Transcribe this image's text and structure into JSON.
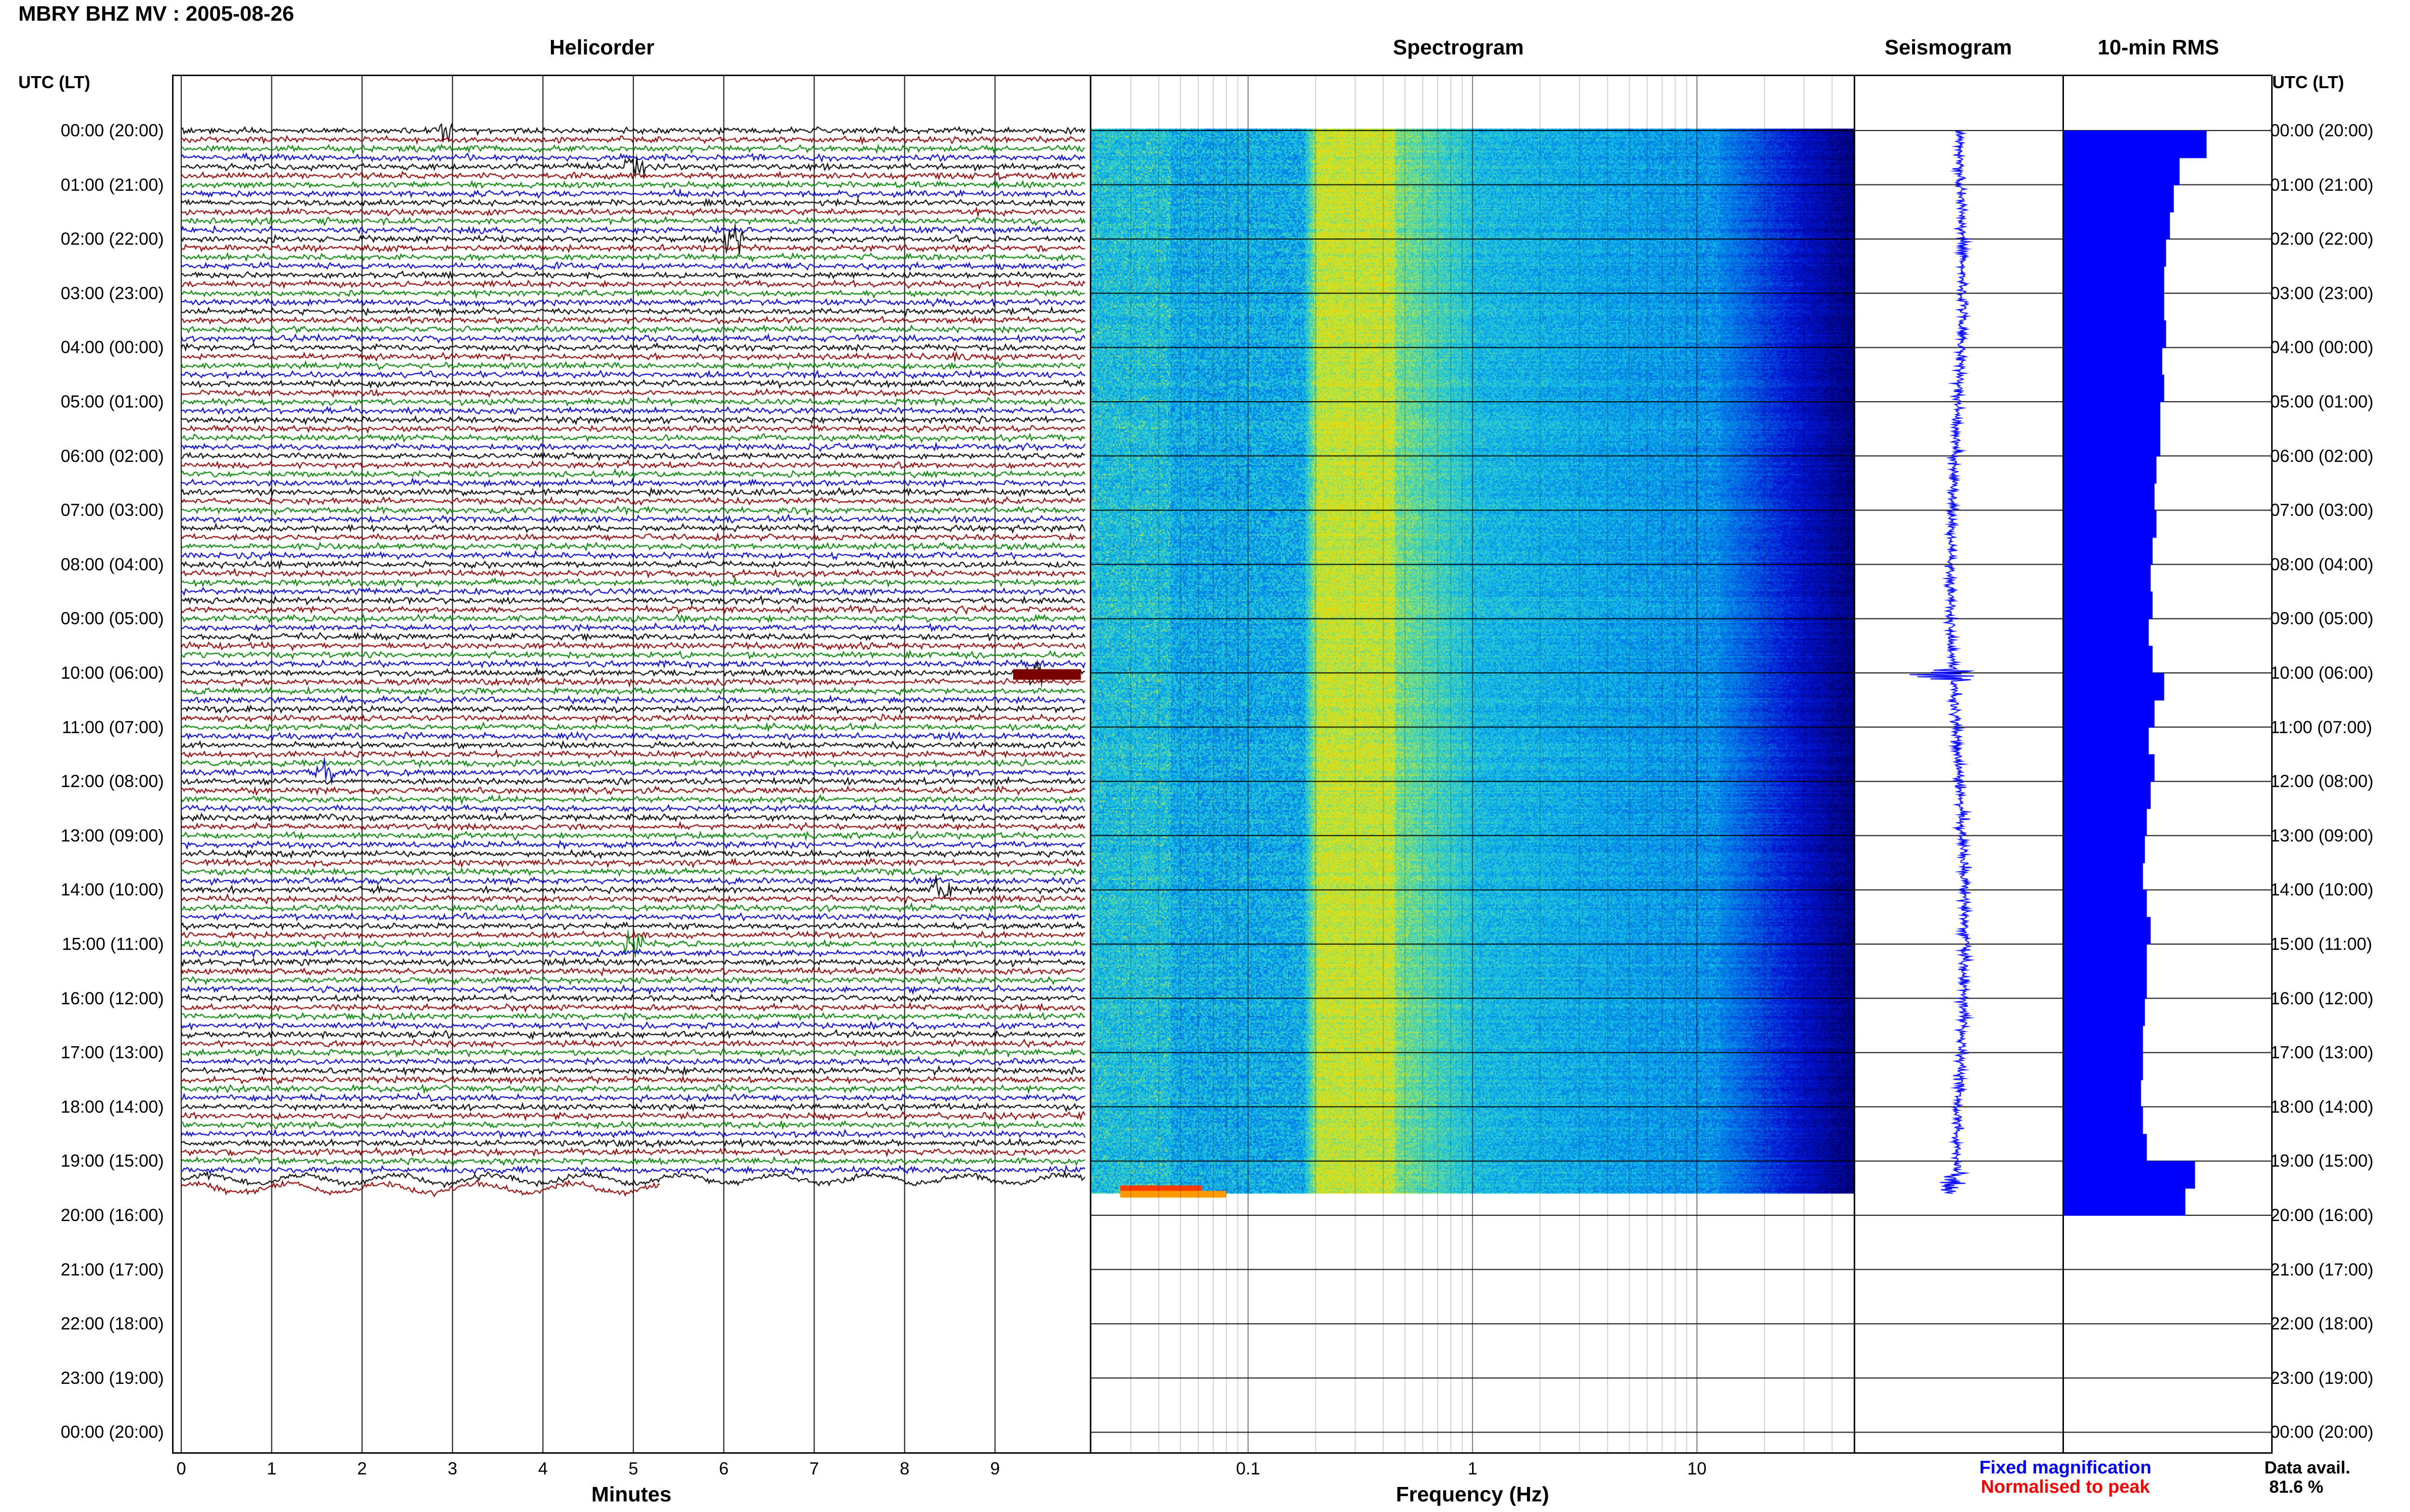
{
  "header": {
    "title": "MBRY BHZ MV : 2005-08-26"
  },
  "panels": {
    "helicorder": "Helicorder",
    "spectrogram": "Spectrogram",
    "seismogram": "Seismogram",
    "rms": "10-min RMS"
  },
  "time_axis": {
    "header": "UTC (LT)",
    "labels": [
      "00:00 (20:00)",
      "01:00 (21:00)",
      "02:00 (22:00)",
      "03:00 (23:00)",
      "04:00 (00:00)",
      "05:00 (01:00)",
      "06:00 (02:00)",
      "07:00 (03:00)",
      "08:00 (04:00)",
      "09:00 (05:00)",
      "10:00 (06:00)",
      "11:00 (07:00)",
      "12:00 (08:00)",
      "13:00 (09:00)",
      "14:00 (10:00)",
      "15:00 (11:00)",
      "16:00 (12:00)",
      "17:00 (13:00)",
      "18:00 (14:00)",
      "19:00 (15:00)",
      "20:00 (16:00)",
      "21:00 (17:00)",
      "22:00 (18:00)",
      "23:00 (19:00)",
      "00:00 (20:00)"
    ]
  },
  "helicorder_axis": {
    "xlabel": "Minutes",
    "ticks": [
      "0",
      "1",
      "2",
      "3",
      "4",
      "5",
      "6",
      "7",
      "8",
      "9"
    ]
  },
  "spectrogram_axis": {
    "xlabel": "Frequency (Hz)",
    "ticks": [
      "0.1",
      "1",
      "10"
    ]
  },
  "legend": {
    "fixed": "Fixed magnification",
    "normalised": "Normalised to peak",
    "fixed_color": "#0000ff",
    "normalised_color": "#ff0000"
  },
  "availability": {
    "label": "Data avail.",
    "value": "81.6 %"
  },
  "chart_data": [
    {
      "type": "line",
      "panel": "Helicorder",
      "xlabel": "Minutes",
      "xlim": [
        0,
        10
      ],
      "rows_per_hour": 6,
      "trace_colors": [
        "#000000",
        "#8b0000",
        "#008000",
        "#0000cd"
      ],
      "data_end_hour": 19.6,
      "events": [
        {
          "hour": 0.05,
          "minute": 2.9
        },
        {
          "hour": 0.65,
          "minute": 5.0
        },
        {
          "hour": 2.0,
          "minute": 6.1
        },
        {
          "hour": 10.0,
          "minute": 9.4
        },
        {
          "hour": 11.8,
          "minute": 1.6
        },
        {
          "hour": 14.0,
          "minute": 8.4
        },
        {
          "hour": 15.05,
          "minute": 5.0
        }
      ]
    },
    {
      "type": "heatmap",
      "panel": "Spectrogram",
      "xlabel": "Frequency (Hz)",
      "xscale": "log",
      "xlim": [
        0.02,
        50
      ],
      "dominant_band_hz": [
        0.2,
        0.45
      ],
      "data_end_hour": 19.6
    },
    {
      "type": "line",
      "panel": "Seismogram",
      "data_end_hour": 19.6
    },
    {
      "type": "bar",
      "panel": "10-min RMS",
      "orientation": "horizontal",
      "bin_minutes": 10,
      "xlim": [
        0,
        1
      ],
      "hours": [
        0.0,
        0.5,
        1.0,
        1.5,
        2.0,
        2.5,
        3.0,
        3.5,
        4.0,
        4.5,
        5.0,
        5.5,
        6.0,
        6.5,
        7.0,
        7.5,
        8.0,
        8.5,
        9.0,
        9.5,
        10.0,
        10.5,
        11.0,
        11.5,
        12.0,
        12.5,
        13.0,
        13.5,
        14.0,
        14.5,
        15.0,
        15.5,
        16.0,
        16.5,
        17.0,
        17.5,
        18.0,
        18.5,
        19.0,
        19.5
      ],
      "values": [
        0.74,
        0.6,
        0.57,
        0.55,
        0.53,
        0.52,
        0.52,
        0.53,
        0.51,
        0.52,
        0.5,
        0.5,
        0.48,
        0.47,
        0.48,
        0.46,
        0.45,
        0.46,
        0.44,
        0.46,
        0.52,
        0.47,
        0.44,
        0.47,
        0.45,
        0.43,
        0.42,
        0.41,
        0.43,
        0.45,
        0.43,
        0.43,
        0.42,
        0.41,
        0.41,
        0.4,
        0.41,
        0.43,
        0.68,
        0.63
      ]
    }
  ]
}
